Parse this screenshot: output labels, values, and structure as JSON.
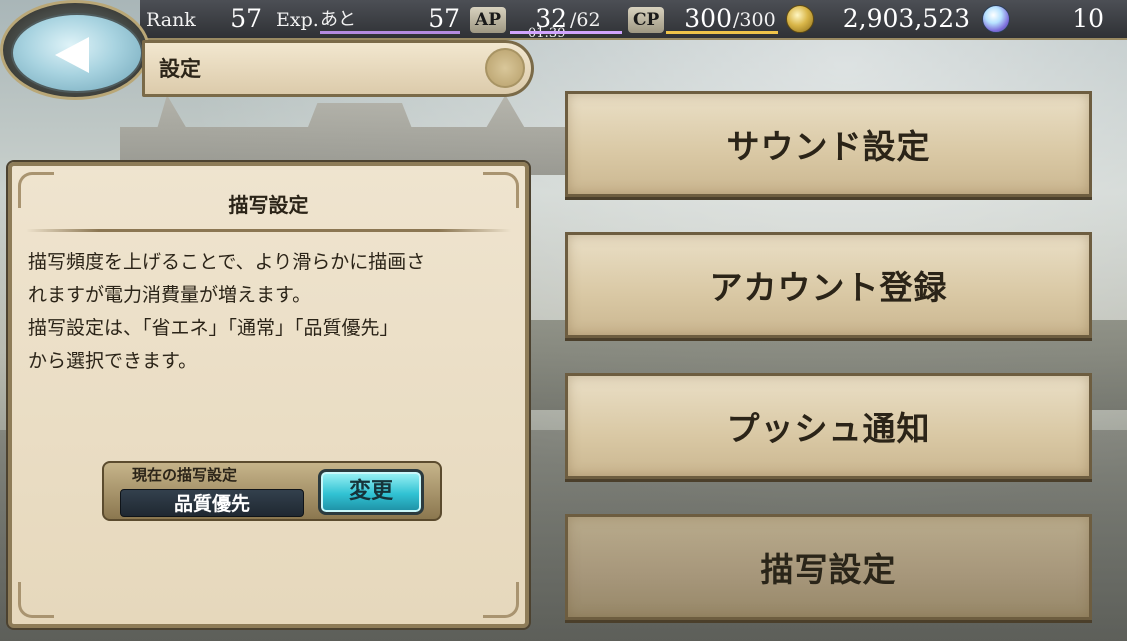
{
  "status": {
    "rank_label": "Rank",
    "rank_value": "57",
    "exp_label": "Exp.",
    "exp_sub_label": "あと",
    "exp_value": "57",
    "ap_label": "AP",
    "ap_value": "32",
    "ap_max": "/62",
    "ap_timer": "01:39",
    "cp_label": "CP",
    "cp_value": "300",
    "cp_max": "/300",
    "gold_value": "2,903,523",
    "gem_value": "10",
    "icons": {
      "gold": "coin-icon",
      "gem": "gem-icon"
    }
  },
  "header": {
    "title": "設定",
    "back_icon": "back-arrow-icon"
  },
  "panel": {
    "title": "描写設定",
    "description_lines": [
      "描写頻度を上げることで、より滑らかに描画さ",
      "れますが電力消費量が増えます。",
      "描写設定は、「省エネ」「通常」「品質優先」",
      "から選択できます。"
    ],
    "current_label": "現在の描写設定",
    "current_value": "品質優先",
    "change_button": "変更"
  },
  "menu": {
    "items": [
      {
        "label": "サウンド設定",
        "active": false
      },
      {
        "label": "アカウント登録",
        "active": false
      },
      {
        "label": "プッシュ通知",
        "active": false
      },
      {
        "label": "描写設定",
        "active": true
      }
    ]
  },
  "colors": {
    "accent_cyan": "#31c2d3",
    "exp_bar": "#b48be0",
    "ap_bar": "#d1a4ff",
    "cp_bar": "#f0c44a",
    "panel_bg": "#efe4cf"
  }
}
